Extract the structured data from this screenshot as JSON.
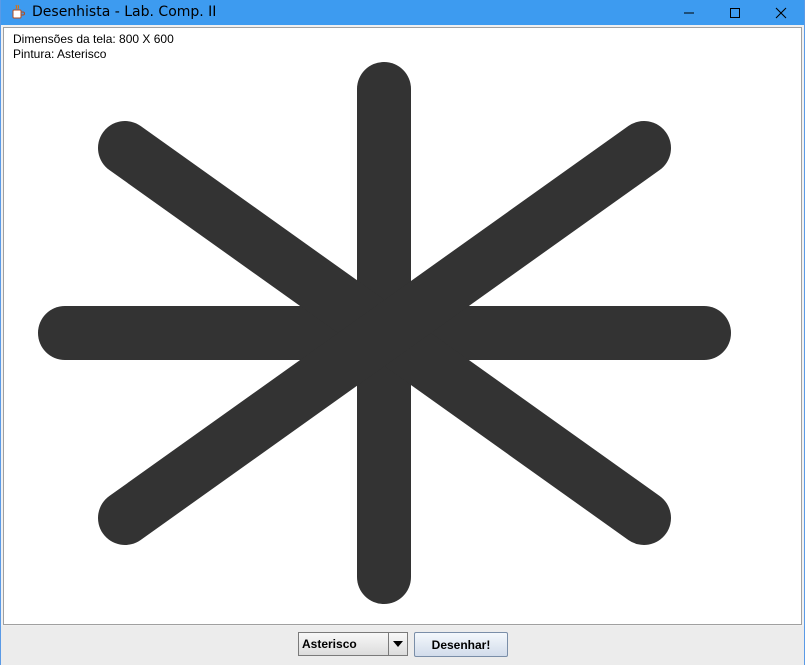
{
  "window": {
    "title": "Desenhista - Lab. Comp. II"
  },
  "canvas": {
    "dimensions_text": "Dimensões da tela: 800 X 600",
    "painting_text": "Pintura: Asterisco",
    "shape": "asterisk",
    "stroke_color": "#333333",
    "background": "#ffffff"
  },
  "controls": {
    "shape_select_value": "Asterisco",
    "draw_button_label": "Desenhar!"
  },
  "colors": {
    "titlebar": "#3d9bf0",
    "stroke": "#333333"
  },
  "icons": {
    "app": "java-coffee-icon",
    "minimize": "minimize-icon",
    "maximize": "maximize-icon",
    "close": "close-icon",
    "dropdown": "chevron-down-icon"
  }
}
